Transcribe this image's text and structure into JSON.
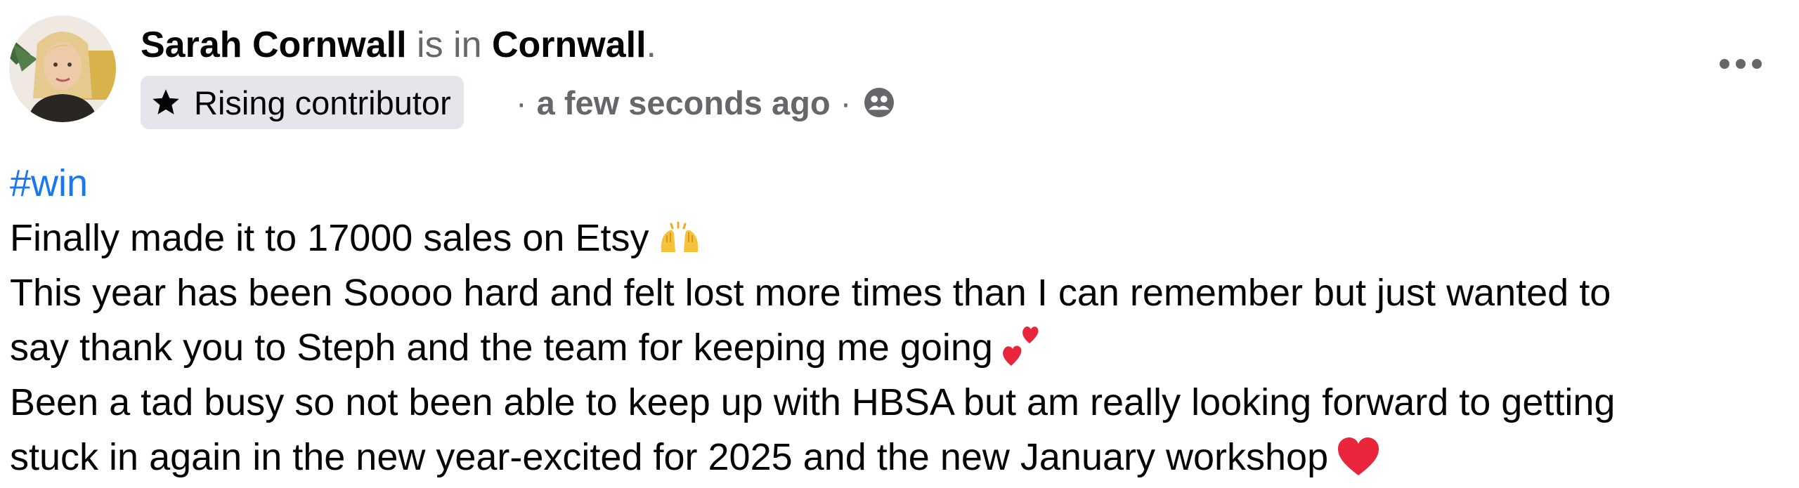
{
  "post": {
    "author": {
      "name": "Sarah Cornwall",
      "connector": " is in ",
      "location": "Cornwall",
      "end_punct": ".",
      "avatar_icon": "profile-photo"
    },
    "badge": {
      "icon": "star-icon",
      "label": "Rising contributor"
    },
    "meta": {
      "separator": "·",
      "time": "a few seconds ago",
      "audience_icon": "group-audience-icon"
    },
    "more_icon": "more-options-icon",
    "content": {
      "hashtag": "#win",
      "lines": [
        "Finally made it to 17000 sales on Etsy",
        "This year has been Soooo hard and felt lost more times than I can remember but just wanted to",
        "say thank you to Steph and the team for keeping me going",
        "Been a tad busy so not been able to keep up with HBSA but am really looking forward to getting",
        "stuck in again in the new year-excited for 2025 and the new January workshop"
      ],
      "emojis": [
        "raising-hands",
        "two-hearts",
        "red-heart"
      ]
    },
    "colors": {
      "hashtag": "#1877f2",
      "muted_text": "#65676b",
      "badge_bg": "#e4e6eb",
      "heart": "#e8253a"
    }
  }
}
